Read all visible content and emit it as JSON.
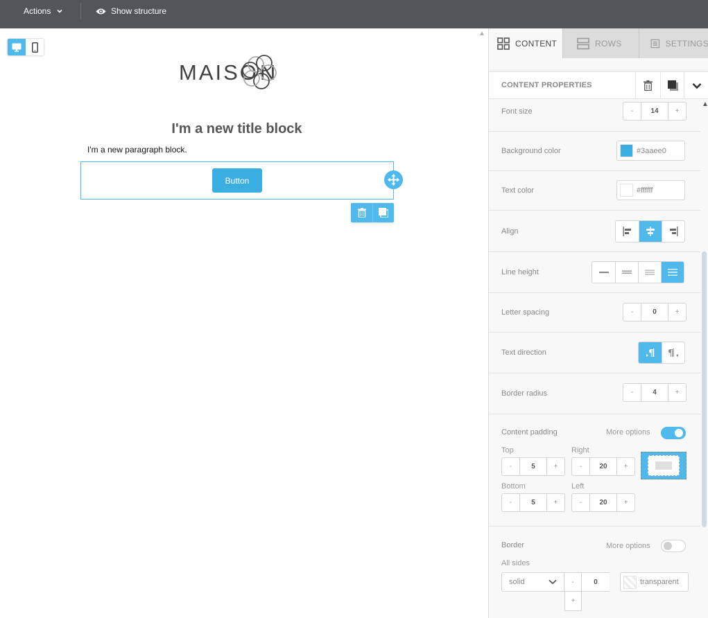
{
  "topbar": {
    "actions_label": "Actions",
    "show_structure_label": "Show structure"
  },
  "canvas": {
    "device_modes": [
      "desktop",
      "mobile"
    ],
    "active_device": "desktop",
    "logo_text_left": "MAISO",
    "logo_text_right": "N",
    "title_block": "I'm a new title block",
    "paragraph_block": "I'm a new paragraph block.",
    "button_label": "Button",
    "button_color": "#3aaee0"
  },
  "panel": {
    "tabs": [
      {
        "label": "CONTENT",
        "icon": "grid-icon",
        "active": true
      },
      {
        "label": "ROWS",
        "icon": "rows-icon",
        "active": false
      },
      {
        "label": "SETTINGS",
        "icon": "settings-doc-icon",
        "active": false
      }
    ],
    "header_title": "CONTENT PROPERTIES",
    "font_size": {
      "label": "Font size",
      "value": "14"
    },
    "background_color": {
      "label": "Background color",
      "value": "#3aaee0"
    },
    "text_color": {
      "label": "Text color",
      "value": "#ffffff"
    },
    "align": {
      "label": "Align",
      "options": [
        "left",
        "center",
        "right"
      ],
      "selected": "center"
    },
    "line_height": {
      "label": "Line height",
      "options": [
        "1",
        "1.2",
        "1.5",
        "2"
      ],
      "selected_index": 3
    },
    "letter_spacing": {
      "label": "Letter spacing",
      "value": "0"
    },
    "text_direction": {
      "label": "Text direction",
      "options": [
        "ltr",
        "rtl"
      ],
      "selected": "ltr"
    },
    "border_radius": {
      "label": "Border radius",
      "value": "4"
    },
    "content_padding": {
      "label": "Content padding",
      "more_options_label": "More options",
      "more_options_on": true,
      "top_label": "Top",
      "top": "5",
      "right_label": "Right",
      "right": "20",
      "bottom_label": "Bottom",
      "bottom": "5",
      "left_label": "Left",
      "left": "20"
    },
    "border": {
      "label": "Border",
      "more_options_label": "More options",
      "more_options_on": false,
      "all_sides_label": "All sides",
      "style": "solid",
      "width": "0",
      "color": "transparent"
    },
    "stepper_minus": "-",
    "stepper_plus": "+"
  }
}
